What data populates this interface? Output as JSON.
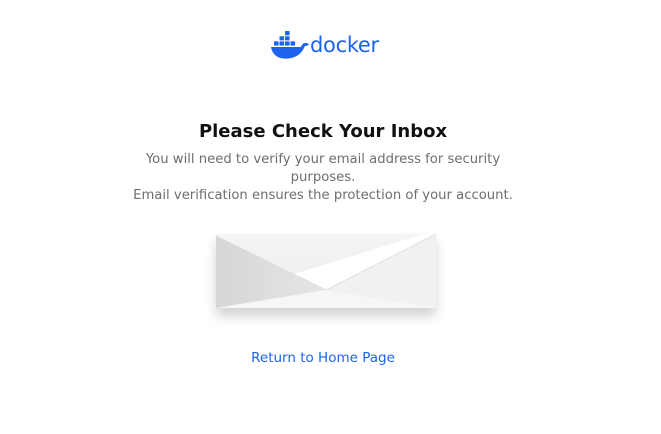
{
  "brand": {
    "name": "docker",
    "color": "#1d63ed",
    "logo_icon": "docker-whale-icon"
  },
  "heading": "Please Check Your Inbox",
  "message": {
    "line1": "You will need to verify your email address for security purposes.",
    "line2": "Email verification ensures the protection of your account."
  },
  "illustration": {
    "icon": "envelope-icon"
  },
  "links": {
    "return_home": "Return to Home Page"
  }
}
